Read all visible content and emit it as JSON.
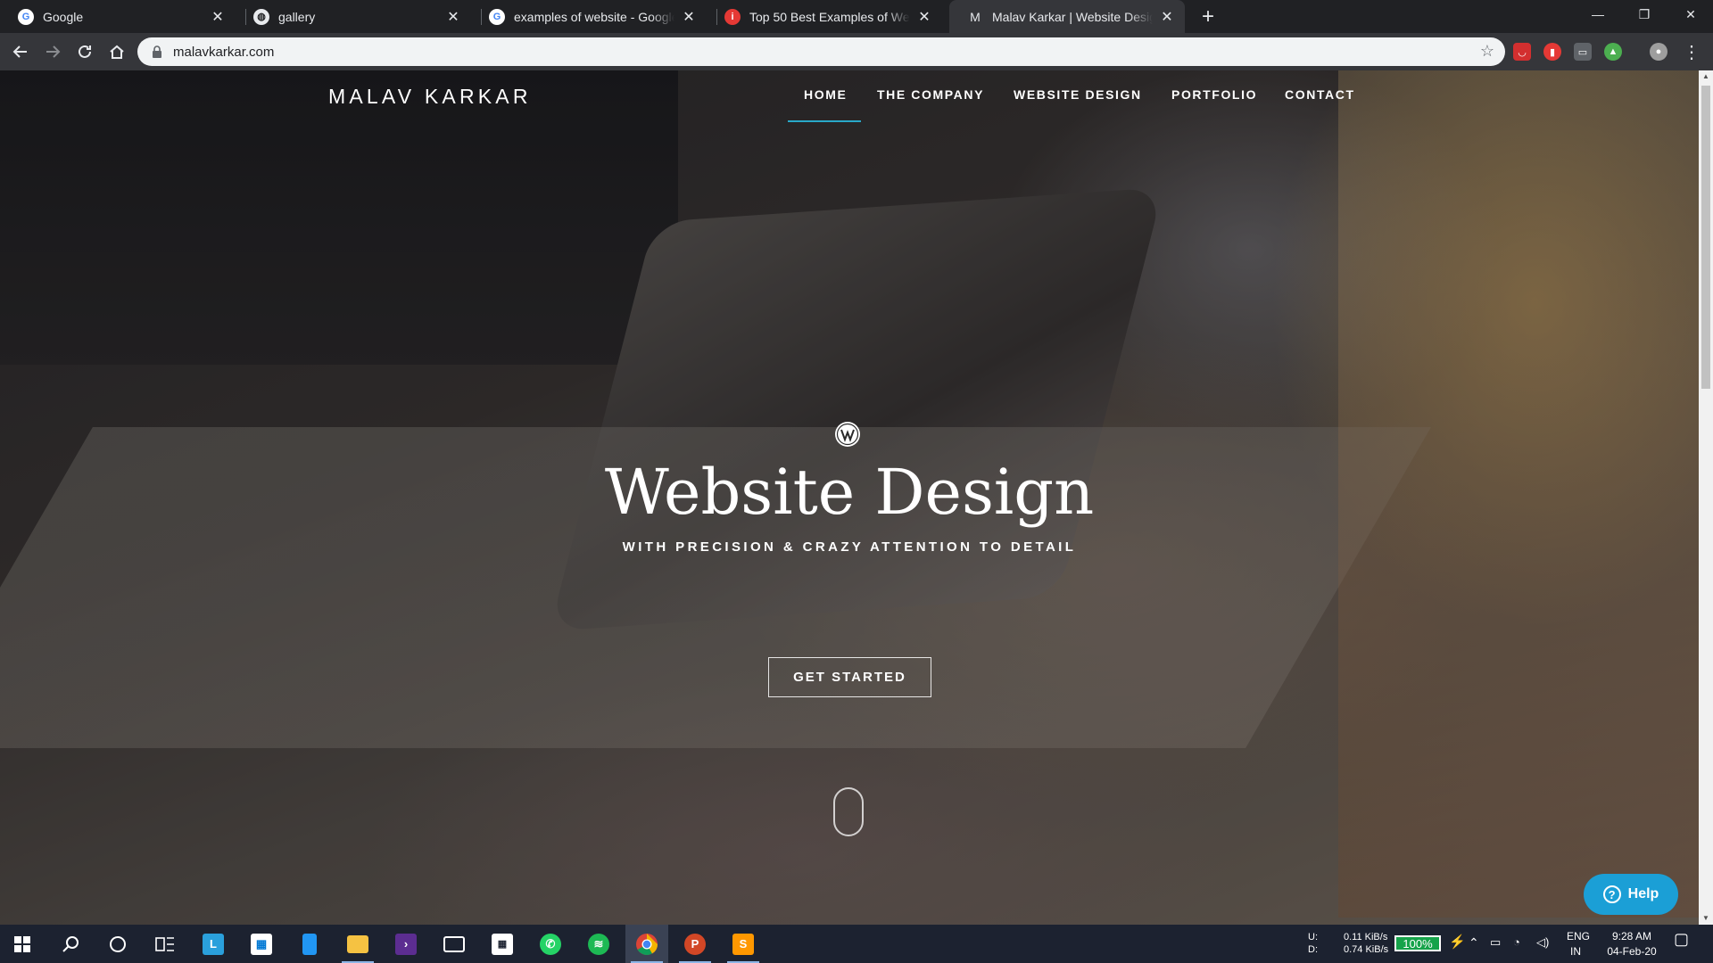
{
  "browser": {
    "tabs": [
      {
        "title": "Google",
        "favicon": "google-icon",
        "active": false
      },
      {
        "title": "gallery",
        "favicon": "globe-icon",
        "active": false
      },
      {
        "title": "examples of website - Google Se",
        "favicon": "google-icon",
        "active": false
      },
      {
        "title": "Top 50 Best Examples of Website",
        "favicon": "info-icon",
        "active": false
      },
      {
        "title": "Malav Karkar | Website Design, S",
        "favicon": "m-icon",
        "active": true
      }
    ],
    "favicon_m_letter": "M",
    "address_bar": {
      "url": "malavkarkar.com"
    }
  },
  "site": {
    "logo": "MALAV KARKAR",
    "nav": [
      "HOME",
      "THE COMPANY",
      "WEBSITE DESIGN",
      "PORTFOLIO",
      "CONTACT"
    ],
    "active_nav": "HOME",
    "accent_color": "#29a8c8",
    "hero": {
      "title": "Website Design",
      "subtitle": "WITH PRECISION & CRAZY ATTENTION TO DETAIL",
      "cta": "GET STARTED"
    },
    "help_button": "Help",
    "help_color": "#1b9fd6"
  },
  "taskbar": {
    "network": {
      "up_label": "U:",
      "down_label": "D:",
      "up": "0.11 KiB/s",
      "down": "0.74 KiB/s"
    },
    "battery": "100%",
    "language": {
      "top": "ENG",
      "bottom": "IN"
    },
    "time": "9:28 AM",
    "date": "04-Feb-20",
    "launcher_letter": "L"
  }
}
